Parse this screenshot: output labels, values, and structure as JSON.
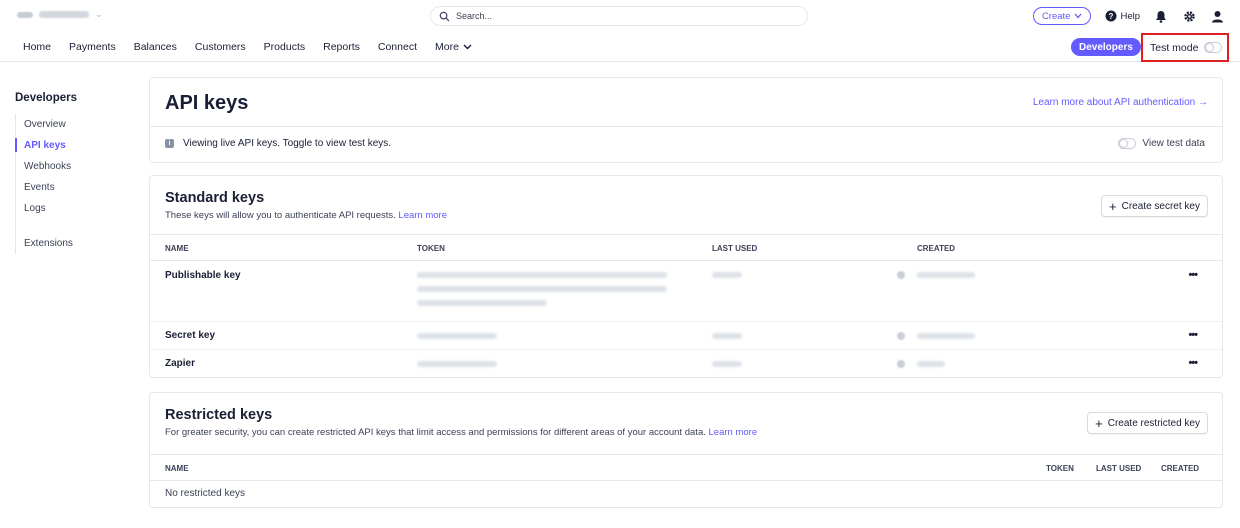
{
  "topbar": {
    "search_placeholder": "Search...",
    "create_label": "Create",
    "help_label": "Help"
  },
  "nav": {
    "items": [
      "Home",
      "Payments",
      "Balances",
      "Customers",
      "Products",
      "Reports",
      "Connect"
    ],
    "more_label": "More",
    "developers_label": "Developers",
    "test_mode_label": "Test mode"
  },
  "sidebar": {
    "title": "Developers",
    "items": [
      "Overview",
      "API keys",
      "Webhooks",
      "Events",
      "Logs"
    ],
    "extensions_label": "Extensions",
    "active": "API keys"
  },
  "api_keys": {
    "title": "API keys",
    "learn_link": "Learn more about API authentication →",
    "banner": "Viewing live API keys. Toggle to view test keys.",
    "view_test_data": "View test data"
  },
  "standard_keys": {
    "title": "Standard keys",
    "subtitle": "These keys will allow you to authenticate API requests.",
    "learn_more": "Learn more",
    "button": "Create secret key",
    "columns": [
      "NAME",
      "TOKEN",
      "LAST USED",
      "CREATED"
    ],
    "rows": [
      {
        "name": "Publishable key"
      },
      {
        "name": "Secret key"
      },
      {
        "name": "Zapier"
      }
    ],
    "more_actions": "•••"
  },
  "restricted_keys": {
    "title": "Restricted keys",
    "subtitle": "For greater security, you can create restricted API keys that limit access and permissions for different areas of your account data.",
    "learn_more": "Learn more",
    "button": "Create restricted key",
    "columns": [
      "NAME",
      "TOKEN",
      "LAST USED",
      "CREATED"
    ],
    "empty": "No restricted keys"
  },
  "colors": {
    "accent": "#635bff",
    "highlight": "#e02020"
  }
}
